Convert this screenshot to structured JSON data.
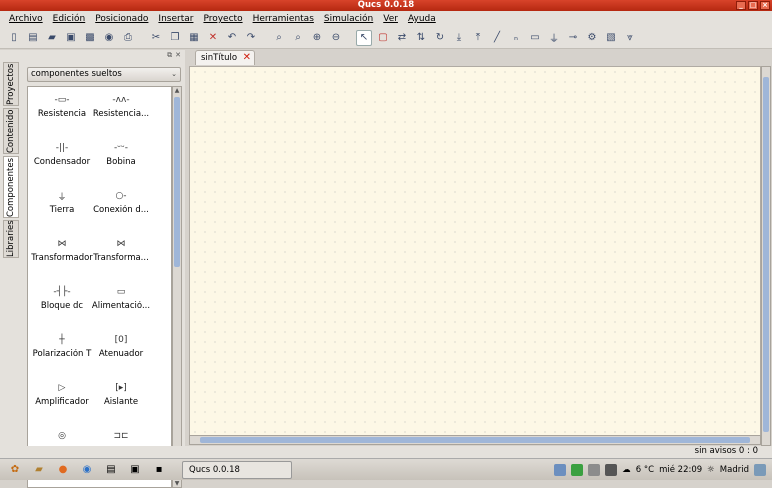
{
  "window": {
    "title": "Qucs 0.0.18"
  },
  "menu": [
    "Archivo",
    "Edición",
    "Posicionado",
    "Insertar",
    "Proyecto",
    "Herramientas",
    "Simulación",
    "Ver",
    "Ayuda"
  ],
  "sidetabs": [
    "Proyectos",
    "Contenido",
    "Componentes",
    "Libraries"
  ],
  "panel": {
    "combo": "componentes sueltos",
    "components": [
      {
        "label": "Resistencia",
        "icon": "resistor-icon"
      },
      {
        "label": "Resistencia...",
        "icon": "resistor-us-icon"
      },
      {
        "label": "Condensador",
        "icon": "capacitor-icon"
      },
      {
        "label": "Bobina",
        "icon": "inductor-icon"
      },
      {
        "label": "Tierra",
        "icon": "ground-icon"
      },
      {
        "label": "Conexión d...",
        "icon": "port-icon"
      },
      {
        "label": "Transformador",
        "icon": "transformer-icon"
      },
      {
        "label": "Transforma...",
        "icon": "transformer-sym-icon"
      },
      {
        "label": "Bloque dc",
        "icon": "dc-block-icon"
      },
      {
        "label": "Alimentació...",
        "icon": "dc-feed-icon"
      },
      {
        "label": "Polarización T",
        "icon": "bias-t-icon"
      },
      {
        "label": "Atenuador",
        "icon": "attenuator-icon"
      },
      {
        "label": "Amplificador",
        "icon": "amplifier-icon"
      },
      {
        "label": "Aislante",
        "icon": "isolator-icon"
      },
      {
        "label": "",
        "icon": "circulator-icon"
      },
      {
        "label": "",
        "icon": "gyrator-icon"
      }
    ]
  },
  "document": {
    "tab_label": "sinTítulo"
  },
  "status": {
    "text": "sin avisos  0 : 0"
  },
  "taskbar": {
    "app_label": "Qucs 0.0.18",
    "temperature": "6 °C",
    "clock": "mié 22:09",
    "location": "Madrid"
  }
}
